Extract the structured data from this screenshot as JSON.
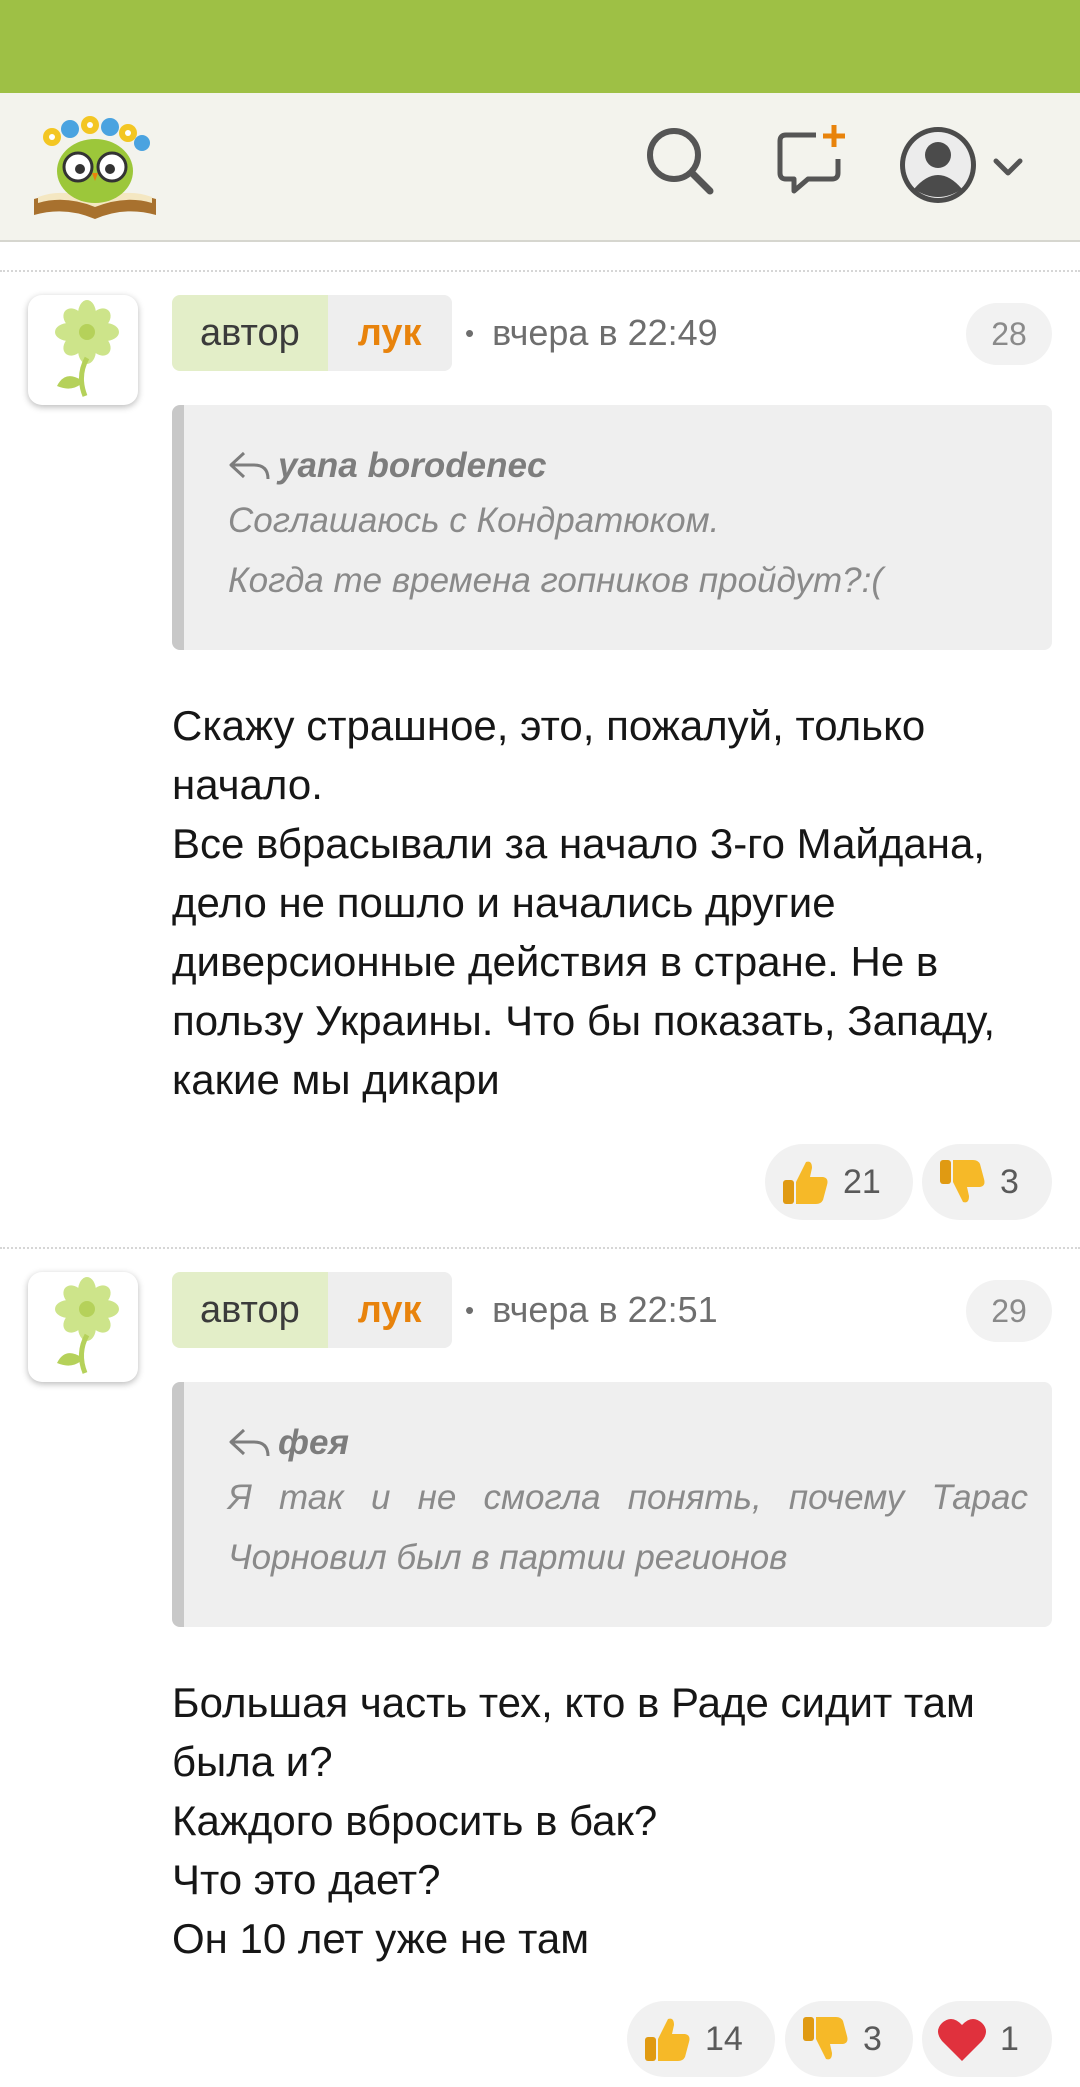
{
  "comments": [
    {
      "role": "автор",
      "username": "лук",
      "time": "вчера в 22:49",
      "number": "28",
      "quote": {
        "author": "yana borodenec",
        "lines": [
          "Соглашаюсь с Кондратюком.",
          "Когда те времена гопников пройдут?:("
        ]
      },
      "body_lines": [
        "Скажу страшное, это, пожалуй, только",
        "начало.",
        "Все вбрасывали за начало 3-го Майдана,",
        "дело не пошло и начались другие",
        "диверсионные действия в стране. Не в",
        "пользу Украины. Что бы показать, Западу,",
        "какие мы дикари"
      ],
      "reactions": {
        "likes": "21",
        "dislikes": "3"
      }
    },
    {
      "role": "автор",
      "username": "лук",
      "time": "вчера в 22:51",
      "number": "29",
      "quote": {
        "author": "фея",
        "lines": [
          "Я так и не смогла понять, почему Тарас",
          "Чорновил был в партии регионов"
        ]
      },
      "body_lines": [
        "Большая часть тех, кто в Раде сидит там",
        "была и?",
        "Каждого вбросить в бак?",
        "Что это дает?",
        "Он 10 лет уже не там"
      ],
      "reactions": {
        "likes": "14",
        "dislikes": "3",
        "hearts": "1"
      }
    }
  ],
  "colors": {
    "status_bar": "#9ec045",
    "header_bg": "#f3f3ed",
    "username": "#e8830c",
    "role_bg": "#e3eec8",
    "thumb": "#f6b928",
    "heart": "#e0313d"
  },
  "icons": {
    "logo": "reading-owl-logo",
    "search": "search-icon",
    "new_post": "new-post-icon",
    "profile": "profile-icon",
    "reply": "reply-arrow-icon",
    "like": "thumbs-up-icon",
    "dislike": "thumbs-down-icon",
    "heart": "heart-icon",
    "avatar": "flower-icon"
  }
}
